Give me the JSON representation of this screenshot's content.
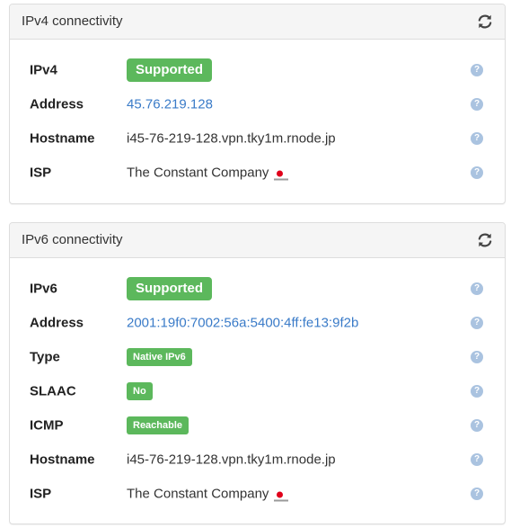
{
  "ipv4": {
    "title": "IPv4 connectivity",
    "rows": [
      {
        "label": "IPv4",
        "value": "Supported"
      },
      {
        "label": "Address",
        "value": "45.76.219.128"
      },
      {
        "label": "Hostname",
        "value": "i45-76-219-128.vpn.tky1m.rnode.jp"
      },
      {
        "label": "ISP",
        "value": "The Constant Company"
      }
    ]
  },
  "ipv6": {
    "title": "IPv6 connectivity",
    "rows": [
      {
        "label": "IPv6",
        "value": "Supported"
      },
      {
        "label": "Address",
        "value": "2001:19f0:7002:56a:5400:4ff:fe13:9f2b"
      },
      {
        "label": "Type",
        "value": "Native IPv6"
      },
      {
        "label": "SLAAC",
        "value": "No"
      },
      {
        "label": "ICMP",
        "value": "Reachable"
      },
      {
        "label": "Hostname",
        "value": "i45-76-219-128.vpn.tky1m.rnode.jp"
      },
      {
        "label": "ISP",
        "value": "The Constant Company"
      }
    ]
  },
  "help_symbol": "?",
  "icons": {
    "refresh": "refresh-icon",
    "help": "help-icon",
    "flag": "japan-flag-icon"
  },
  "colors": {
    "badge_green": "#5cb85c",
    "link_blue": "#3a7bc8",
    "help_blue": "#aac3e0",
    "heading_bg": "#f5f5f5"
  }
}
